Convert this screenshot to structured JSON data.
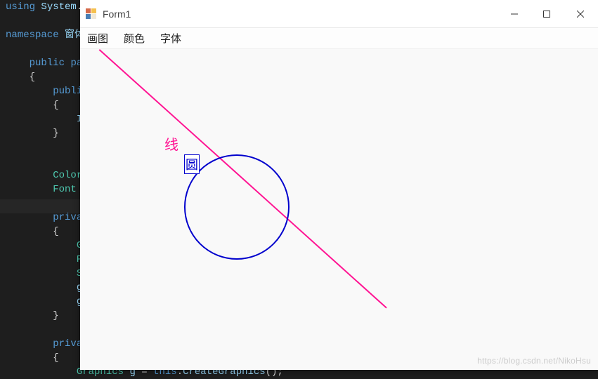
{
  "code": {
    "l1": "using System.Windows.Forms;",
    "l2": "namespace 窗体",
    "l3": "    public par",
    "l4": "    {",
    "l5": "        public",
    "l6": "        {",
    "l7": "            In",
    "l8": "        }",
    "l9": "        Color ",
    "l10": "        Font m",
    "l11": "        privat",
    "l12": "        {",
    "l13": "            Gr",
    "l14": "            Pe",
    "l15": "            So",
    "l16": "            g.",
    "l17": "            g.",
    "l18": "        }",
    "l19": "        privat",
    "l20": "        {",
    "l21": "            Graphics g = "
  },
  "window": {
    "title": "Form1",
    "menu": {
      "draw": "画图",
      "color": "颜色",
      "font": "字体"
    },
    "labels": {
      "line": "线",
      "circle": "圆"
    }
  },
  "watermark": "https://blog.csdn.net/NikoHsu"
}
